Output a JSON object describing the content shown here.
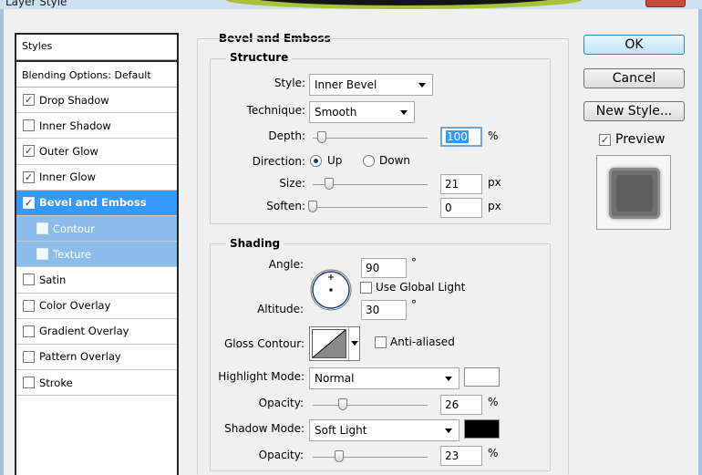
{
  "window": {
    "title": "Layer Style"
  },
  "styles_panel": {
    "header": "Styles",
    "blending": "Blending Options: Default",
    "items": [
      {
        "label": "Drop Shadow",
        "checked": true
      },
      {
        "label": "Inner Shadow",
        "checked": false
      },
      {
        "label": "Outer Glow",
        "checked": true
      },
      {
        "label": "Inner Glow",
        "checked": true
      },
      {
        "label": "Bevel and Emboss",
        "checked": true,
        "selected": true
      },
      {
        "label": "Contour",
        "checked": false,
        "sub": true
      },
      {
        "label": "Texture",
        "checked": false,
        "sub": true
      },
      {
        "label": "Satin",
        "checked": false
      },
      {
        "label": "Color Overlay",
        "checked": false
      },
      {
        "label": "Gradient Overlay",
        "checked": false
      },
      {
        "label": "Pattern Overlay",
        "checked": false
      },
      {
        "label": "Stroke",
        "checked": false
      }
    ]
  },
  "bevel": {
    "title": "Bevel and Emboss",
    "structure": {
      "title": "Structure",
      "style_label": "Style:",
      "style_value": "Inner Bevel",
      "technique_label": "Technique:",
      "technique_value": "Smooth",
      "depth_label": "Depth:",
      "depth_value": "100",
      "depth_unit": "%",
      "depth_slider": 0.08,
      "direction_label": "Direction:",
      "direction_up": "Up",
      "direction_down": "Down",
      "direction_selected": "Up",
      "size_label": "Size:",
      "size_value": "21",
      "size_unit": "px",
      "size_slider": 0.14,
      "soften_label": "Soften:",
      "soften_value": "0",
      "soften_unit": "px",
      "soften_slider": 0.0
    },
    "shading": {
      "title": "Shading",
      "angle_label": "Angle:",
      "angle_value": "90",
      "angle_unit": "°",
      "use_global_light": "Use Global Light",
      "use_global_light_checked": false,
      "altitude_label": "Altitude:",
      "altitude_value": "30",
      "altitude_unit": "°",
      "gloss_label": "Gloss Contour:",
      "anti_aliased": "Anti-aliased",
      "anti_aliased_checked": false,
      "highlight_label": "Highlight Mode:",
      "highlight_value": "Normal",
      "highlight_color": "#ffffff",
      "highlight_opacity_label": "Opacity:",
      "highlight_opacity": "26",
      "highlight_opacity_unit": "%",
      "highlight_opacity_slider": 0.26,
      "shadow_label": "Shadow Mode:",
      "shadow_value": "Soft Light",
      "shadow_color": "#000000",
      "shadow_opacity_label": "Opacity:",
      "shadow_opacity": "23",
      "shadow_opacity_unit": "%",
      "shadow_opacity_slider": 0.23
    }
  },
  "buttons": {
    "ok": "OK",
    "cancel": "Cancel",
    "new_style": "New Style...",
    "preview": "Preview",
    "preview_checked": true
  },
  "colors": {
    "selection": "#3399ff",
    "sub_selection": "#8bbcea"
  },
  "icons": {
    "checkbox": "check-icon",
    "dropdown": "chevron-down-icon",
    "angle": "angle-dial-icon",
    "contour": "gloss-contour-icon"
  }
}
